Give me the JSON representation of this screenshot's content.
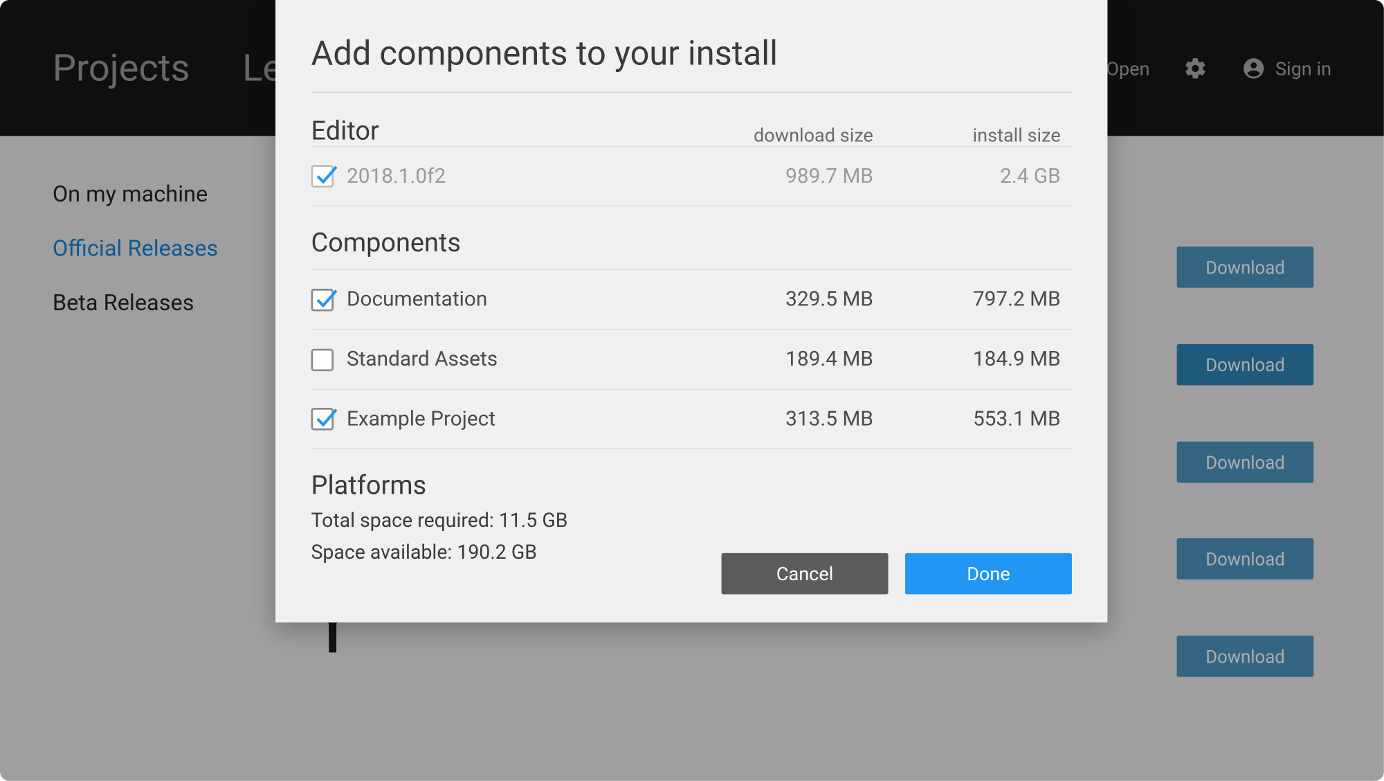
{
  "topbar": {
    "tabs": [
      "Projects",
      "Learn"
    ],
    "open_label": "Open",
    "signin_label": "Sign in"
  },
  "sidebar": {
    "items": [
      {
        "label": "On my machine",
        "active": false
      },
      {
        "label": "Official Releases",
        "active": true
      },
      {
        "label": "Beta Releases",
        "active": false
      }
    ]
  },
  "downloads": {
    "button_label": "Download"
  },
  "modal": {
    "title": "Add components to your install",
    "editor_section": "Editor",
    "components_section": "Components",
    "platforms_section": "Platforms",
    "col_download": "download size",
    "col_install": "install size",
    "editor_row": {
      "label": "2018.1.0f2",
      "download": "989.7 MB",
      "install": "2.4 GB",
      "checked": true,
      "disabled": true
    },
    "components": [
      {
        "label": "Documentation",
        "download": "329.5 MB",
        "install": "797.2 MB",
        "checked": true
      },
      {
        "label": "Standard Assets",
        "download": "189.4 MB",
        "install": "184.9 MB",
        "checked": false
      },
      {
        "label": "Example Project",
        "download": "313.5 MB",
        "install": "553.1 MB",
        "checked": true
      }
    ],
    "total_required_label": "Total space required: ",
    "total_required_value": "11.5 GB",
    "space_available_label": "Space available: ",
    "space_available_value": "190.2 GB",
    "cancel_label": "Cancel",
    "done_label": "Done"
  }
}
